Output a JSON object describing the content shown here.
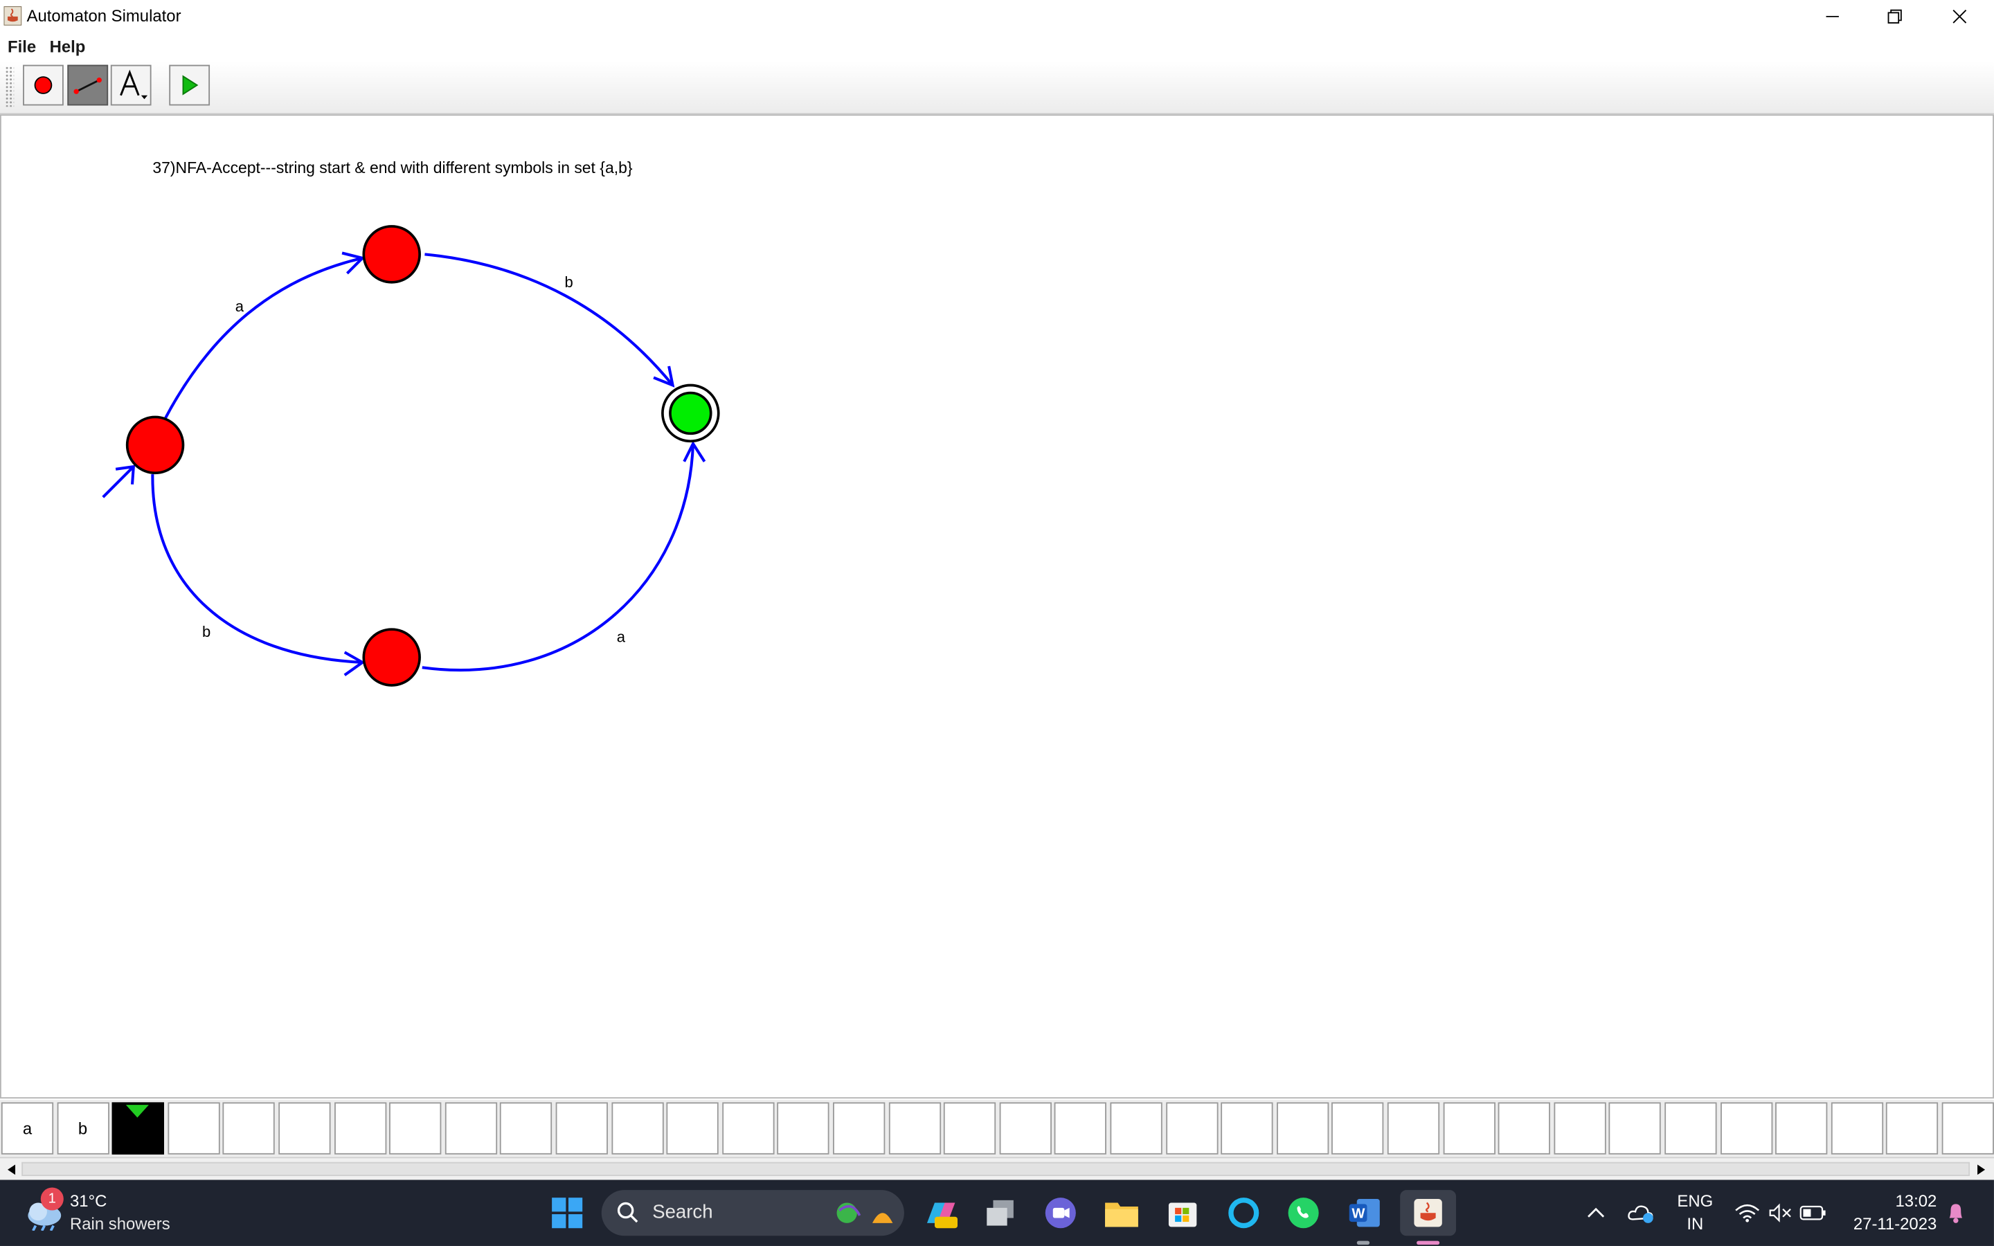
{
  "window": {
    "title": "Automaton Simulator"
  },
  "menu": {
    "file": "File",
    "help": "Help"
  },
  "toolbar": {
    "tools": [
      {
        "name": "state-tool",
        "icon": "red-circle-icon"
      },
      {
        "name": "transition-tool",
        "icon": "arrow-line-icon",
        "active": true
      },
      {
        "name": "text-tool",
        "icon": "letter-a-icon"
      },
      {
        "name": "run-tool",
        "icon": "green-play-icon"
      }
    ]
  },
  "canvas": {
    "caption": "37)NFA-Accept---string start & end with different symbols in set {a,b}",
    "states": [
      {
        "id": "q0",
        "type": "start",
        "color": "#ff0000"
      },
      {
        "id": "q1",
        "type": "normal",
        "color": "#ff0000"
      },
      {
        "id": "q2",
        "type": "accepting",
        "color": "#00ff00"
      },
      {
        "id": "q3",
        "type": "normal",
        "color": "#ff0000"
      }
    ],
    "transitions": [
      {
        "from": "q0",
        "to": "q1",
        "label": "a"
      },
      {
        "from": "q1",
        "to": "q2",
        "label": "b"
      },
      {
        "from": "q0",
        "to": "q3",
        "label": "b"
      },
      {
        "from": "q3",
        "to": "q2",
        "label": "a"
      }
    ],
    "edge_color": "#0000ff"
  },
  "tape": {
    "cells": [
      "a",
      "b",
      "",
      "",
      "",
      "",
      "",
      "",
      "",
      "",
      "",
      "",
      "",
      "",
      "",
      "",
      "",
      "",
      "",
      "",
      "",
      "",
      "",
      "",
      "",
      "",
      "",
      "",
      "",
      "",
      "",
      "",
      "",
      "",
      "",
      "",
      ""
    ],
    "head_index": 2
  },
  "taskbar": {
    "weather_badge": "1",
    "temperature": "31°C",
    "condition": "Rain showers",
    "search_label": "Search",
    "lang_line1": "ENG",
    "lang_line2": "IN",
    "time": "13:02",
    "date": "27-11-2023"
  }
}
